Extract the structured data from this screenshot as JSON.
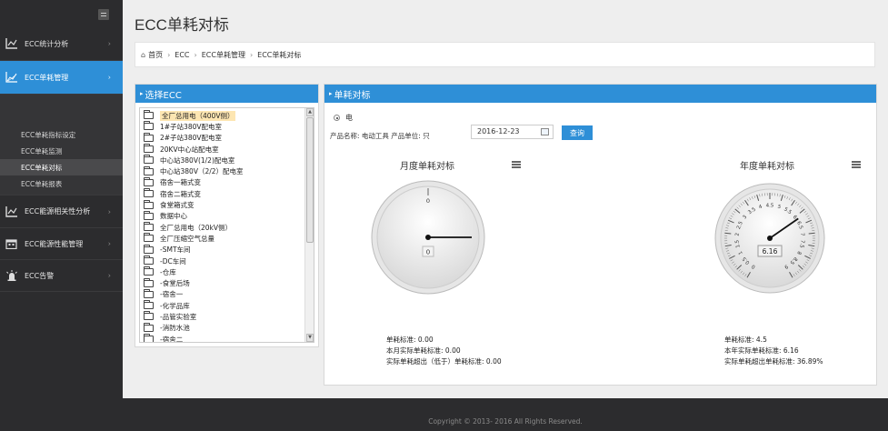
{
  "sidebar": {
    "items": [
      {
        "label": "ECC统计分析",
        "icon": "line-chart-icon",
        "active": false
      },
      {
        "label": "ECC单耗管理",
        "icon": "area-chart-icon",
        "active": true
      },
      {
        "label": "ECC能源相关性分析",
        "icon": "line-chart-icon",
        "active": false
      },
      {
        "label": "ECC能源性能管理",
        "icon": "calendar-icon",
        "active": false
      },
      {
        "label": "ECC告警",
        "icon": "alarm-icon",
        "active": false
      }
    ],
    "submenu": [
      "ECC单耗指标设定",
      "ECC单耗监测",
      "ECC单耗对标",
      "ECC单耗报表"
    ],
    "current_sub": 2
  },
  "page": {
    "title": "ECC单耗对标"
  },
  "breadcrumb": [
    "首页",
    "ECC",
    "ECC单耗管理",
    "ECC单耗对标"
  ],
  "left_panel": {
    "title": "选择ECC",
    "tree": [
      "全厂总用电（400V侧）",
      "1#子站380V配电室",
      "2#子站380V配电室",
      "20KV中心站配电室",
      "中心站380V(1/2)配电室",
      "中心站380V（2/2）配电室",
      "宿舍一箱式变",
      "宿舍二箱式变",
      "食堂箱式变",
      "数据中心",
      "全厂总用电（20kV侧）",
      "全厂压缩空气总量",
      "-SMT车间",
      "-DC车间",
      "-仓库",
      "-食堂后场",
      "-宿舍一",
      "-化学品库",
      "-品管实验室",
      "-消防水池",
      "-宿舍二"
    ],
    "selected_index": 0
  },
  "right_panel": {
    "title": "单耗对标",
    "radio_label": "电",
    "product_text": "产品名称: 电动工具   产品单位: 只",
    "date_value": "2016-12-23",
    "query_label": "查询",
    "monthly": {
      "title": "月度单耗对标",
      "gauge_label": "0",
      "value_display": "0",
      "value": 0,
      "stats": [
        "单耗标准: 0.00",
        "本月实际单耗标准: 0.00",
        "实际单耗超出（低于）单耗标准: 0.00"
      ]
    },
    "yearly": {
      "title": "年度单耗对标",
      "gauge_labels": [
        "0",
        "0.5",
        "1",
        "1.5",
        "2",
        "2.5",
        "3",
        "3.5",
        "4",
        "4.5",
        "5",
        "5.5",
        "6",
        "6.5",
        "7",
        "7.5",
        "8",
        "8.5",
        "9"
      ],
      "value_display": "6.16",
      "value": 6.16,
      "gauge_min": 0,
      "gauge_max": 9,
      "stats": [
        "单耗标准: 4.5",
        "本年实际单耗标准: 6.16",
        "实际单耗超出单耗标准: 36.89%"
      ]
    }
  },
  "footer": {
    "text": "Copyright © 2013- 2016 All Rights Reserved."
  },
  "colors": {
    "accent": "#2e8fd7",
    "sidebar_bg": "#2c2c2e",
    "selected_tree": "#fde6b2"
  }
}
